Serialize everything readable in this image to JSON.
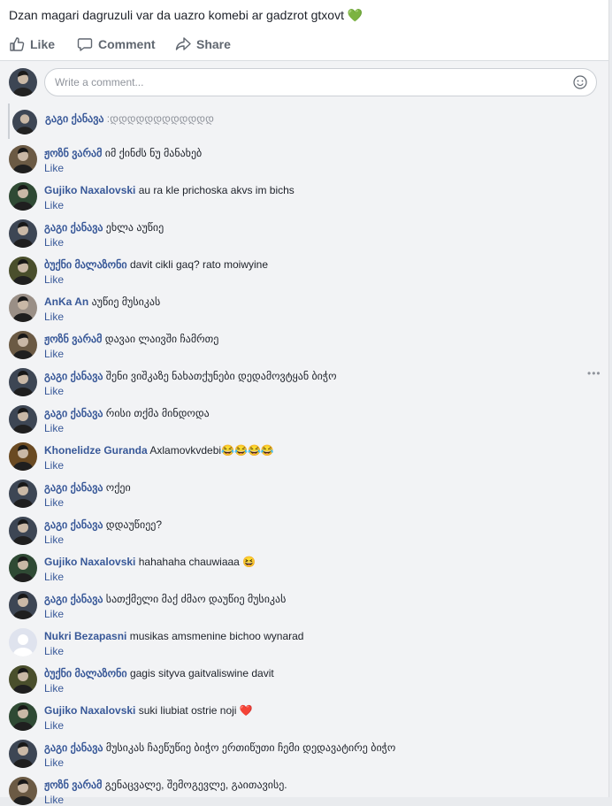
{
  "post": {
    "text": "Dzan magari dagruzuli var da uazro komebi ar gadzrot gtxovt",
    "emoji": "💚"
  },
  "actions": [
    {
      "label": "Like"
    },
    {
      "label": "Comment"
    },
    {
      "label": "Share"
    }
  ],
  "composer": {
    "placeholder": "Write a comment..."
  },
  "reply_preview": {
    "author": "გაგი ქანავა",
    "text": ":დდდდდდდდდდდდ"
  },
  "comments": [
    {
      "author": "ჟოზნ ვარამ",
      "text": "იმ ქინძს ნუ მანახებ",
      "like": "Like",
      "avatar": "#6b5a44"
    },
    {
      "author": "Gujiko Naxalovski",
      "text": "au ra kle prichoska akvs im bichs",
      "like": "Like",
      "avatar": "#2f4a34"
    },
    {
      "author": "გაგი ქანავა",
      "text": "ეხლა აუწიე",
      "like": "Like",
      "avatar": "#3d4654"
    },
    {
      "author": "ბუქნი მალაზონი",
      "text": "davit cikli gaq? rato moiwyine",
      "like": "Like",
      "avatar": "#4a4f2c"
    },
    {
      "author": "AnKa An",
      "text": "აუწიე მუსიკას",
      "like": "Like",
      "avatar": "#9a8f86"
    },
    {
      "author": "ჟოზნ ვარამ",
      "text": "დავაი ლაივში ჩამრთე",
      "like": "Like",
      "avatar": "#6b5a44"
    },
    {
      "author": "გაგი ქანავა",
      "text": "შენი ვიშკაზე ნახათქუნები დედამოვტყან ბიჭო",
      "like": "Like",
      "avatar": "#3d4654"
    },
    {
      "author": "გაგი ქანავა",
      "text": "რისი თქმა მინდოდა",
      "like": "Like",
      "avatar": "#3d4654"
    },
    {
      "author": "Khonelidze Guranda",
      "text": "Axlamovkvdebi😂😂😂😂",
      "like": "Like",
      "avatar": "#6a4a22"
    },
    {
      "author": "გაგი ქანავა",
      "text": "ოქეი",
      "like": "Like",
      "avatar": "#3d4654"
    },
    {
      "author": "გაგი ქანავა",
      "text": "დდაუწიეე?",
      "like": "Like",
      "avatar": "#3d4654"
    },
    {
      "author": "Gujiko Naxalovski",
      "text": "hahahaha chauwiaaa 😆",
      "like": "Like",
      "avatar": "#2f4a34"
    },
    {
      "author": "გაგი ქანავა",
      "text": "სათქმელი მაქ ძმაო დაუწიე მუსიკას",
      "like": "Like",
      "avatar": "#3d4654"
    },
    {
      "author": "Nukri Bezapasni",
      "text": "musikas amsmenine bichoo wynarad",
      "like": "Like",
      "avatar": "#dfe3ee"
    },
    {
      "author": "ბუქნი მალაზონი",
      "text": "gagis sityva gaitvaliswine davit",
      "like": "Like",
      "avatar": "#4a4f2c"
    },
    {
      "author": "Gujiko Naxalovski",
      "text": "suki liubiat ostrie noji ❤️",
      "like": "Like",
      "avatar": "#2f4a34"
    },
    {
      "author": "გაგი ქანავა",
      "text": "მუსიკას ჩაეწუწიე ბიჭო ერთიწუთი ჩემი დედავატირე ბიჭო",
      "like": "Like",
      "avatar": "#3d4654"
    },
    {
      "author": "ჟოზნ ვარამ",
      "text": "გენაცვალე, შემოგევლე, გაითავისე.",
      "like": "Like",
      "avatar": "#6b5a44"
    }
  ],
  "icons": {
    "like": "thumbs-up-icon",
    "comment": "speech-bubble-icon",
    "share": "share-arrow-icon",
    "emoji": "smiley-icon",
    "more": "more-options-icon"
  },
  "colors": {
    "link": "#385898",
    "muted": "#606770",
    "comments_bg": "#f2f3f5"
  }
}
